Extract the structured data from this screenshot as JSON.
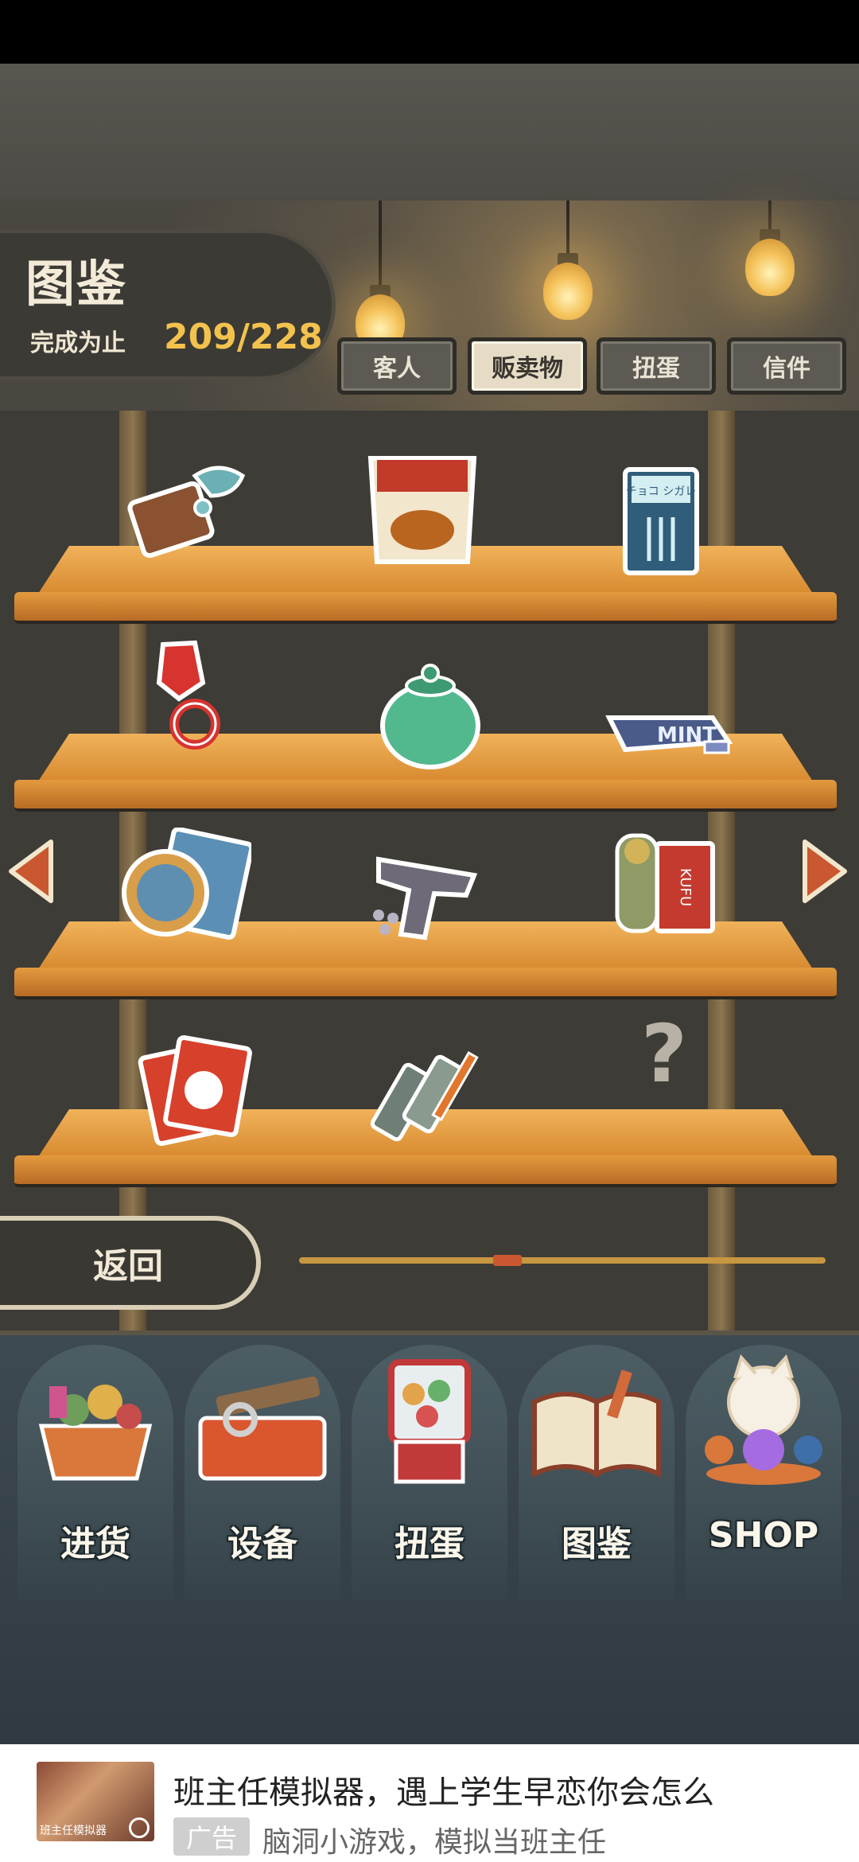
{
  "header": {
    "title": "图鉴",
    "progress_label": "完成为止",
    "progress_value": "209/228"
  },
  "tabs": [
    {
      "label": "客人",
      "active": false
    },
    {
      "label": "贩卖物",
      "active": true
    },
    {
      "label": "扭蛋",
      "active": false
    },
    {
      "label": "信件",
      "active": false
    }
  ],
  "shelf_items": [
    {
      "row": 1,
      "slot": 1,
      "icon": "taiyaki-sweets-icon"
    },
    {
      "row": 1,
      "slot": 2,
      "icon": "senbei-snack-bag-icon"
    },
    {
      "row": 1,
      "slot": 3,
      "icon": "chocolate-box-icon",
      "text": "チョコ シガレ"
    },
    {
      "row": 2,
      "slot": 1,
      "icon": "ring-pop-candy-icon"
    },
    {
      "row": 2,
      "slot": 2,
      "icon": "green-candy-jar-icon"
    },
    {
      "row": 2,
      "slot": 3,
      "icon": "mint-gum-pack-icon",
      "text": "MINT"
    },
    {
      "row": 3,
      "slot": 1,
      "icon": "trading-card-sticker-icon"
    },
    {
      "row": 3,
      "slot": 2,
      "icon": "toy-cap-gun-icon"
    },
    {
      "row": 3,
      "slot": 3,
      "icon": "mummy-toy-box-icon",
      "text": "KUFU"
    },
    {
      "row": 4,
      "slot": 1,
      "icon": "menko-cards-icon"
    },
    {
      "row": 4,
      "slot": 2,
      "icon": "paint-tubes-icon"
    },
    {
      "row": 4,
      "slot": 3,
      "icon": "unknown-item-icon",
      "text": "?"
    }
  ],
  "page": {
    "current": 5,
    "total": 19
  },
  "back_button": "返回",
  "bottom_nav": [
    {
      "label": "进货",
      "icon": "stock-basket-icon"
    },
    {
      "label": "设备",
      "icon": "toolbox-icon"
    },
    {
      "label": "扭蛋",
      "icon": "gacha-machine-icon"
    },
    {
      "label": "图鉴",
      "icon": "open-book-icon"
    },
    {
      "label": "SHOP",
      "icon": "lucky-cat-icon"
    }
  ],
  "ad": {
    "title": "班主任模拟器，遇上学生早恋你会怎么",
    "badge": "广告",
    "description": "脑洞小游戏，模拟当班主任",
    "thumb_caption": "班主任模拟器"
  },
  "colors": {
    "accent_gold": "#f2c24d",
    "arrow_red": "#c9572f",
    "shelf_wood": "#e39a3e"
  }
}
